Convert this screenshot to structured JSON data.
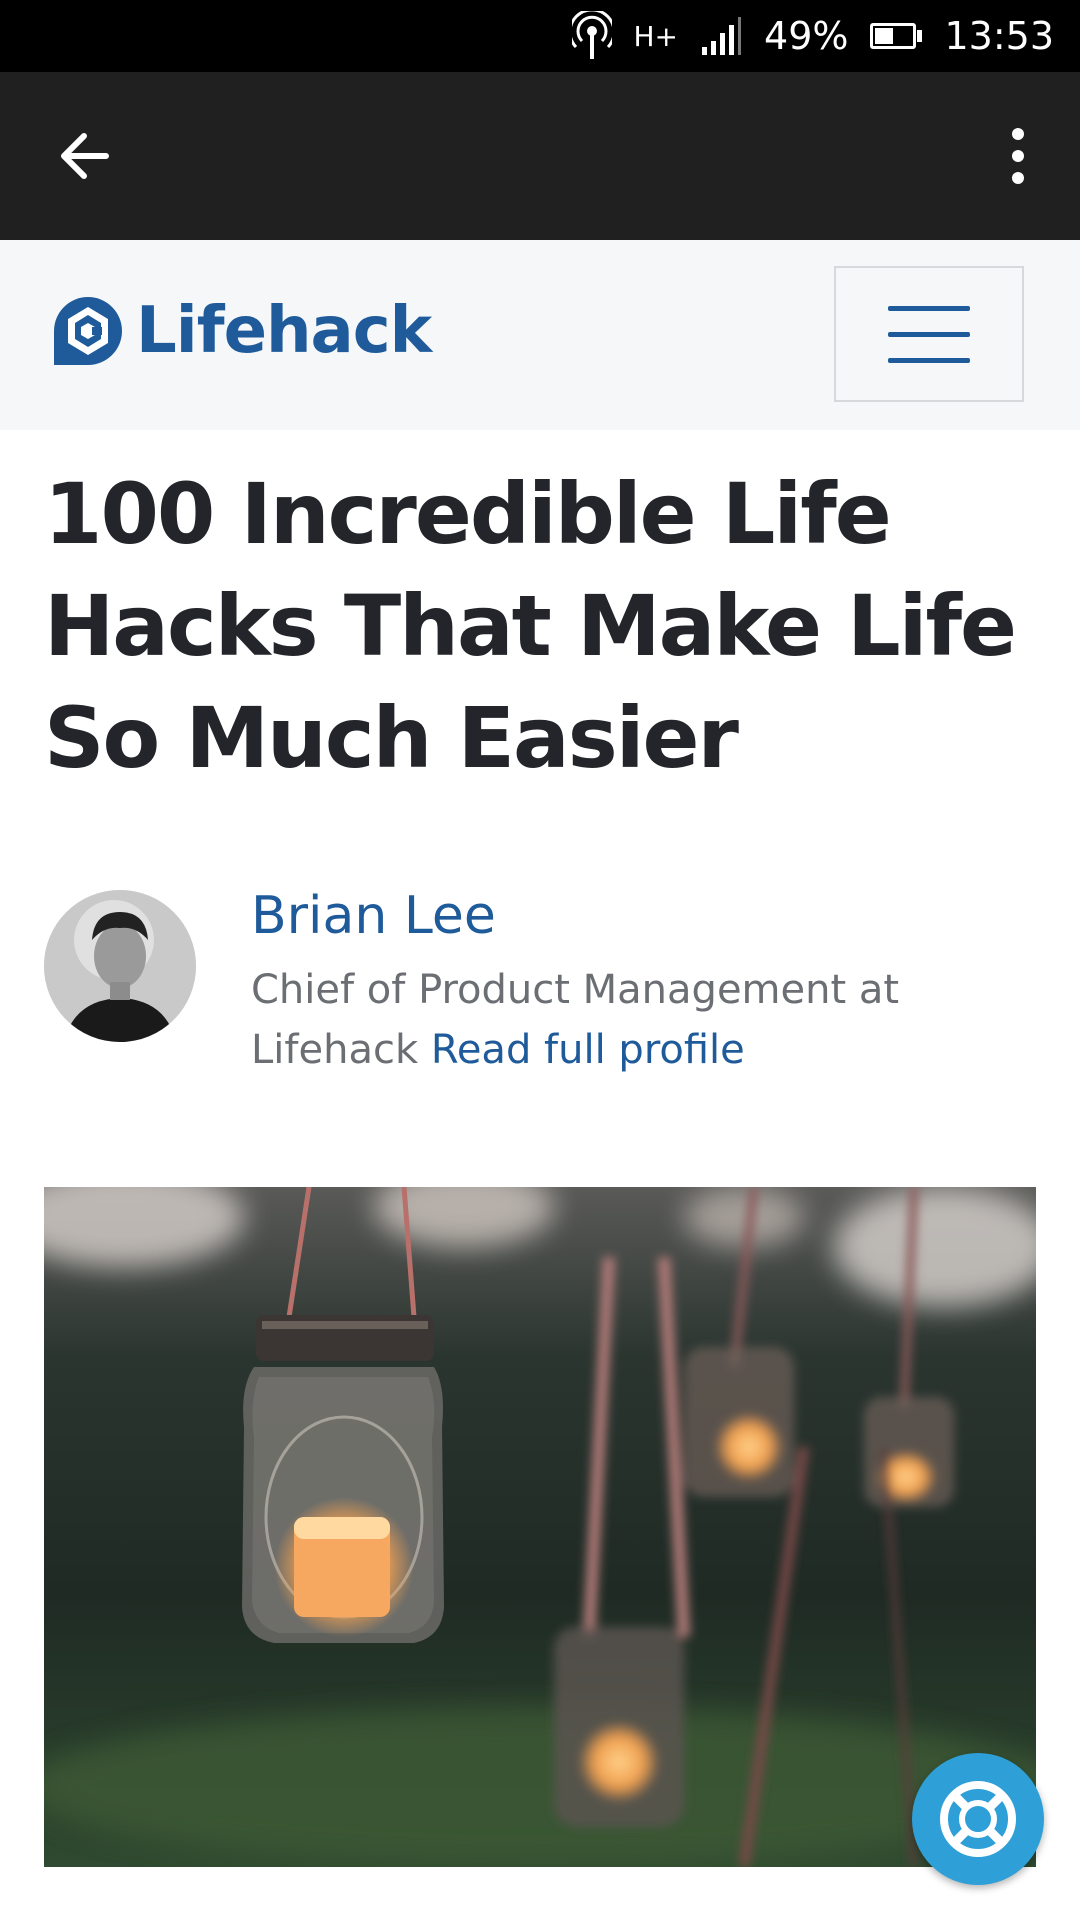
{
  "status_bar": {
    "network_type": "H+",
    "battery_percent_label": "49%",
    "battery_level": 0.49,
    "time": "13:53",
    "icons": [
      "hotspot-icon",
      "network-type-icon",
      "signal-icon",
      "battery-icon"
    ]
  },
  "app_bar": {
    "back_icon": "arrow-left-icon",
    "more_icon": "more-vert-icon"
  },
  "site_header": {
    "logo_text": "Lifehack",
    "logo_icon": "lifehack-logo-icon",
    "menu_icon": "hamburger-icon",
    "brand_color": "#1f5b9a"
  },
  "article": {
    "title": "100 Incredible Life Hacks That Make Life So Much Easier",
    "author": {
      "name": "Brian Lee",
      "bio": "Chief of Product Management at Lifehack",
      "profile_link": "Read full profile"
    },
    "hero_image": "hanging-jar-candles-image"
  },
  "help_button": {
    "icon": "lifebuoy-icon",
    "color": "#2f9fd8"
  }
}
